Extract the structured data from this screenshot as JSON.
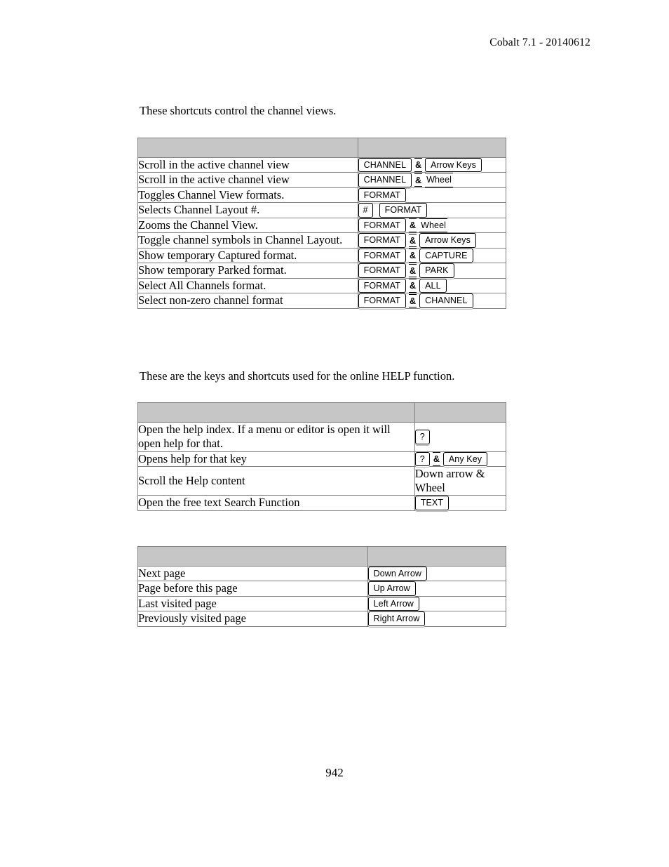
{
  "header": {
    "running_head": "Cobalt 7.1 - 20140612"
  },
  "footer": {
    "page_number": "942"
  },
  "sections": [
    {
      "intro": "These shortcuts control the channel views.",
      "table_name": "channel-views",
      "columns": [
        "",
        ""
      ],
      "rows": [
        {
          "description": "Scroll in the active channel view",
          "keys": [
            {
              "type": "key",
              "label": "CHANNEL"
            },
            {
              "type": "amp",
              "label": "&"
            },
            {
              "type": "key",
              "label": "Arrow Keys"
            }
          ]
        },
        {
          "description": "Scroll in the active channel view",
          "keys": [
            {
              "type": "key",
              "label": "CHANNEL"
            },
            {
              "type": "amp",
              "label": "&"
            },
            {
              "type": "key-open",
              "label": "Wheel"
            }
          ]
        },
        {
          "description": "Toggles Channel View formats.",
          "keys": [
            {
              "type": "key",
              "label": "FORMAT"
            }
          ]
        },
        {
          "description": "Selects Channel Layout #.",
          "keys": [
            {
              "type": "key",
              "label": "#"
            },
            {
              "type": "gap",
              "label": ""
            },
            {
              "type": "key",
              "label": "FORMAT"
            }
          ]
        },
        {
          "description": "Zooms the Channel View.",
          "keys": [
            {
              "type": "key",
              "label": "FORMAT"
            },
            {
              "type": "amp",
              "label": "&"
            },
            {
              "type": "key-open",
              "label": "Wheel"
            }
          ]
        },
        {
          "description": "Toggle channel symbols in Channel Layout.",
          "keys": [
            {
              "type": "key",
              "label": "FORMAT"
            },
            {
              "type": "amp",
              "label": "&"
            },
            {
              "type": "key",
              "label": "Arrow Keys"
            }
          ]
        },
        {
          "description": "Show temporary Captured format.",
          "keys": [
            {
              "type": "key",
              "label": "FORMAT"
            },
            {
              "type": "amp",
              "label": "&"
            },
            {
              "type": "key",
              "label": "CAPTURE"
            }
          ]
        },
        {
          "description": "Show temporary Parked format.",
          "keys": [
            {
              "type": "key",
              "label": "FORMAT"
            },
            {
              "type": "amp",
              "label": "&"
            },
            {
              "type": "key",
              "label": "PARK"
            }
          ]
        },
        {
          "description": "Select All Channels format.",
          "keys": [
            {
              "type": "key",
              "label": "FORMAT"
            },
            {
              "type": "amp",
              "label": "&"
            },
            {
              "type": "key",
              "label": "ALL"
            }
          ]
        },
        {
          "description": "Select non-zero channel format",
          "keys": [
            {
              "type": "key",
              "label": "FORMAT"
            },
            {
              "type": "amp",
              "label": "&"
            },
            {
              "type": "key",
              "label": "CHANNEL"
            }
          ]
        }
      ]
    },
    {
      "intro": "These are the keys and shortcuts used for the online HELP function.",
      "table_name": "help",
      "columns": [
        "",
        ""
      ],
      "rows": [
        {
          "description": "Open the help index. If a menu or editor is open it will open help for that.",
          "keys": [
            {
              "type": "key",
              "label": "?"
            }
          ]
        },
        {
          "description": "Opens help for that key",
          "keys": [
            {
              "type": "key",
              "label": "?"
            },
            {
              "type": "amp",
              "label": "&"
            },
            {
              "type": "key",
              "label": "Any Key"
            }
          ]
        },
        {
          "description": "Scroll the Help content",
          "plain_text": "Down arrow & Wheel",
          "keys": []
        },
        {
          "description": "Open the free text Search Function",
          "keys": [
            {
              "type": "key",
              "label": "TEXT"
            }
          ]
        }
      ]
    },
    {
      "intro": "",
      "table_name": "navigation",
      "columns": [
        "",
        ""
      ],
      "rows": [
        {
          "description": "Next page",
          "keys": [
            {
              "type": "key",
              "label": "Down Arrow"
            }
          ]
        },
        {
          "description": "Page before this page",
          "keys": [
            {
              "type": "key",
              "label": "Up Arrow"
            }
          ]
        },
        {
          "description": "Last visited page",
          "keys": [
            {
              "type": "key",
              "label": "Left Arrow"
            }
          ]
        },
        {
          "description": "Previously visited page",
          "keys": [
            {
              "type": "key",
              "label": "Right Arrow"
            }
          ]
        }
      ]
    }
  ],
  "colors": {
    "table_header_fill": "#c6c6c6",
    "table_border": "#808080",
    "key_border": "#000000",
    "page_background": "#ffffff",
    "text": "#000000"
  }
}
